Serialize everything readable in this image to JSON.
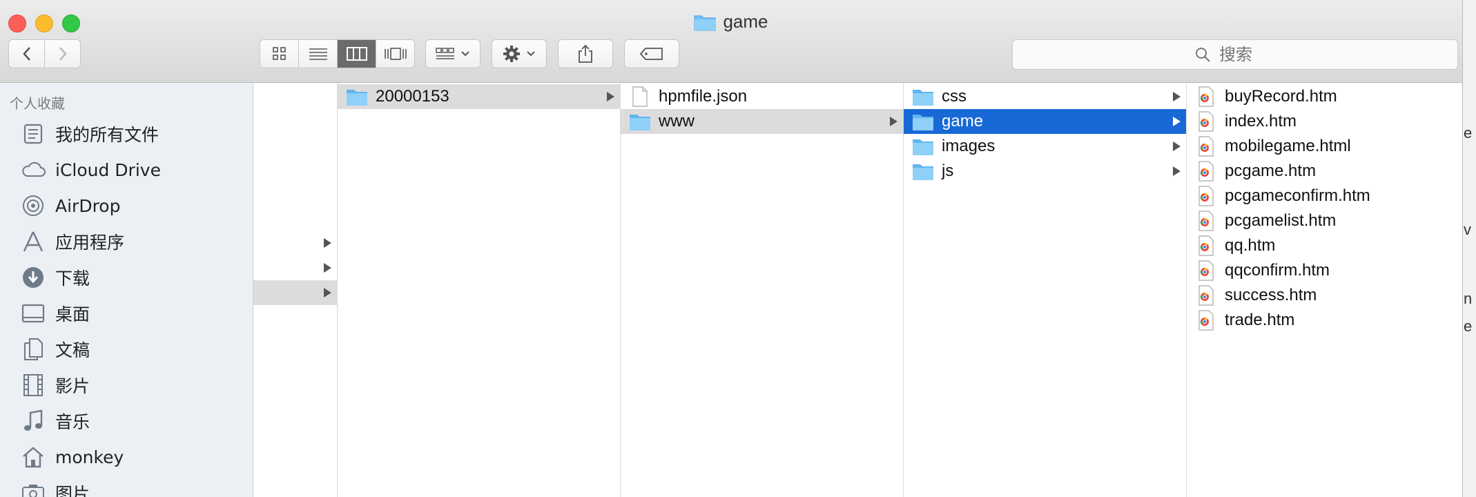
{
  "window": {
    "title": "game"
  },
  "background": {
    "peek_right": [
      "e",
      "v",
      "n",
      "e"
    ]
  },
  "toolbar": {
    "back_label": "back",
    "forward_label": "forward",
    "view_modes": [
      "icon-view",
      "list-view",
      "column-view",
      "cover-flow-view"
    ],
    "active_view": "column-view",
    "search_placeholder": "搜索"
  },
  "sidebar": {
    "header": "个人收藏",
    "items": [
      {
        "label": "我的所有文件",
        "icon": "all-files-icon"
      },
      {
        "label": "iCloud Drive",
        "icon": "cloud-icon"
      },
      {
        "label": "AirDrop",
        "icon": "airdrop-icon"
      },
      {
        "label": "应用程序",
        "icon": "applications-icon"
      },
      {
        "label": "下载",
        "icon": "download-icon"
      },
      {
        "label": "桌面",
        "icon": "desktop-icon"
      },
      {
        "label": "文稿",
        "icon": "documents-icon"
      },
      {
        "label": "影片",
        "icon": "movies-icon"
      },
      {
        "label": "音乐",
        "icon": "music-icon"
      },
      {
        "label": "monkey",
        "icon": "home-icon"
      },
      {
        "label": "图片",
        "icon": "pictures-icon"
      }
    ]
  },
  "columns": {
    "col2": [
      {
        "name": "20000153",
        "type": "folder",
        "selected": "gray"
      }
    ],
    "col3": [
      {
        "name": "hpmfile.json",
        "type": "file"
      },
      {
        "name": "www",
        "type": "folder",
        "selected": "gray"
      }
    ],
    "col4": [
      {
        "name": "css",
        "type": "folder"
      },
      {
        "name": "game",
        "type": "folder",
        "selected": "blue"
      },
      {
        "name": "images",
        "type": "folder"
      },
      {
        "name": "js",
        "type": "folder"
      }
    ],
    "col5": [
      {
        "name": "buyRecord.htm",
        "type": "htm"
      },
      {
        "name": "index.htm",
        "type": "htm"
      },
      {
        "name": "mobilegame.html",
        "type": "htm"
      },
      {
        "name": "pcgame.htm",
        "type": "htm"
      },
      {
        "name": "pcgameconfirm.htm",
        "type": "htm"
      },
      {
        "name": "pcgamelist.htm",
        "type": "htm"
      },
      {
        "name": "qq.htm",
        "type": "htm"
      },
      {
        "name": "qqconfirm.htm",
        "type": "htm"
      },
      {
        "name": "success.htm",
        "type": "htm"
      },
      {
        "name": "trade.htm",
        "type": "htm"
      }
    ]
  },
  "colors": {
    "selection_blue": "#1868d6",
    "selection_gray": "#dcdcdc",
    "folder_blue": "#6fc1f5"
  }
}
